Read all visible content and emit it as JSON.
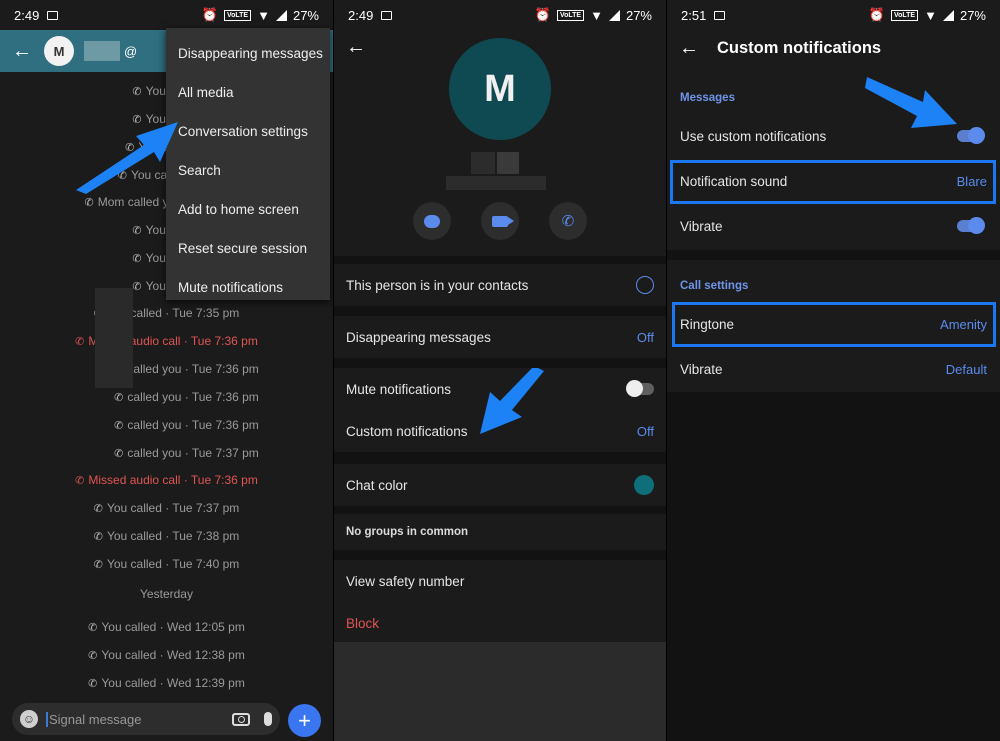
{
  "status_bars": [
    {
      "time": "2:49",
      "volte": "VoLTE",
      "battery": "27%"
    },
    {
      "time": "2:49",
      "volte": "VoLTE",
      "battery": "27%"
    },
    {
      "time": "2:51",
      "volte": "VoLTE",
      "battery": "27%"
    }
  ],
  "conversation": {
    "avatar_letter": "M",
    "at_symbol": "@",
    "menu_items": [
      "Disappearing messages",
      "All media",
      "Conversation settings",
      "Search",
      "Add to home screen",
      "Reset secure session",
      "Mute notifications"
    ],
    "calls": [
      {
        "text": "You called",
        "type": "normal"
      },
      {
        "text": "You called",
        "type": "normal"
      },
      {
        "text": "You c",
        "type": "normal"
      },
      {
        "text": "You called y",
        "type": "normal"
      },
      {
        "text": "Mom called y",
        "type": "normal"
      },
      {
        "text": "You called",
        "type": "normal"
      },
      {
        "text": "You called",
        "type": "normal"
      },
      {
        "text": "You called",
        "type": "normal"
      },
      {
        "text": "You called · Tue 7:35 pm",
        "type": "normal"
      },
      {
        "text": "Missed audio call · Tue 7:36 pm",
        "type": "missed"
      },
      {
        "text": "called you · Tue 7:36 pm",
        "type": "normal"
      },
      {
        "text": "called you · Tue 7:36 pm",
        "type": "normal"
      },
      {
        "text": "called you · Tue 7:36 pm",
        "type": "normal"
      },
      {
        "text": "called you · Tue 7:37 pm",
        "type": "normal"
      },
      {
        "text": "Missed audio call · Tue 7:36 pm",
        "type": "missed"
      },
      {
        "text": "You called · Tue 7:37 pm",
        "type": "normal"
      },
      {
        "text": "You called · Tue 7:38 pm",
        "type": "normal"
      },
      {
        "text": "You called · Tue 7:40 pm",
        "type": "normal"
      },
      {
        "text": "Yesterday",
        "type": "date"
      },
      {
        "text": "You called · Wed 12:05 pm",
        "type": "normal"
      },
      {
        "text": "You called · Wed 12:38 pm",
        "type": "normal"
      },
      {
        "text": "You called · Wed 12:39 pm",
        "type": "normal"
      }
    ],
    "composer_placeholder": "Signal message",
    "fab_label": "+"
  },
  "contact_settings": {
    "avatar_letter": "M",
    "contacts_row": "This person is in your contacts",
    "disappearing_label": "Disappearing messages",
    "disappearing_value": "Off",
    "mute_label": "Mute notifications",
    "custom_label": "Custom notifications",
    "custom_value": "Off",
    "chat_color_label": "Chat color",
    "groups_label": "No groups in common",
    "safety_label": "View safety number",
    "block_label": "Block",
    "colors": {
      "chat_color": "#0e6f7a"
    }
  },
  "custom_notifications": {
    "title": "Custom notifications",
    "messages_section": "Messages",
    "use_custom_label": "Use custom notifications",
    "notification_sound_label": "Notification sound",
    "notification_sound_value": "Blare",
    "vibrate_label": "Vibrate",
    "call_section": "Call settings",
    "ringtone_label": "Ringtone",
    "ringtone_value": "Amenity",
    "call_vibrate_label": "Vibrate",
    "call_vibrate_value": "Default"
  },
  "theme": {
    "accent": "#3a76f0",
    "highlight": "#1c78f0",
    "toolbar": "#2f6f80",
    "missed": "#e05454"
  }
}
